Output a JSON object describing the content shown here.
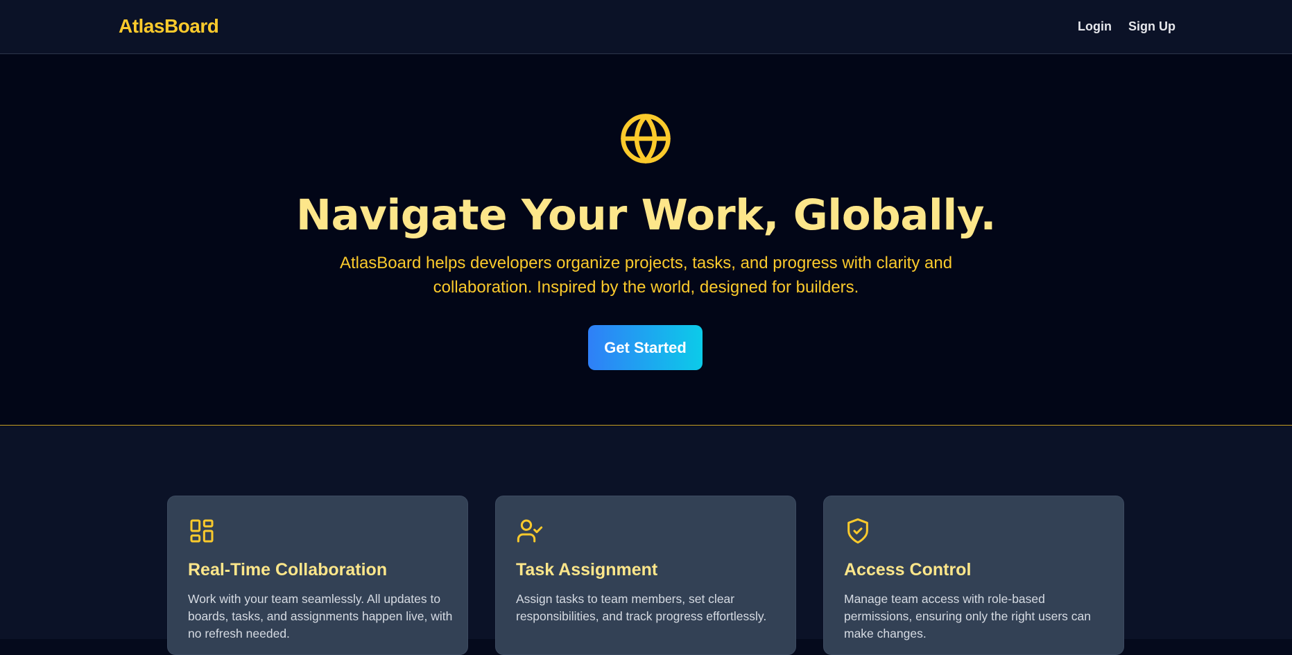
{
  "nav": {
    "brand": "AtlasBoard",
    "login_label": "Login",
    "signup_label": "Sign Up"
  },
  "hero": {
    "icon": "globe-icon",
    "title": "Navigate Your Work, Globally.",
    "subtitle": "AtlasBoard helps developers organize projects, tasks, and progress with clarity and collaboration. Inspired by the world, designed for builders.",
    "cta_label": "Get Started"
  },
  "features": [
    {
      "icon": "dashboard-grid-icon",
      "title": "Real-Time Collaboration",
      "description": "Work with your team seamlessly. All updates to boards, tasks, and assignments happen live, with no refresh needed."
    },
    {
      "icon": "user-check-icon",
      "title": "Task Assignment",
      "description": "Assign tasks to team members, set clear responsibilities, and track progress effortlessly."
    },
    {
      "icon": "shield-check-icon",
      "title": "Access Control",
      "description": "Manage team access with role-based permissions, ensuring only the right users can make changes."
    }
  ],
  "colors": {
    "accent": "#fbca2c",
    "title": "#fde68a",
    "background": "#020617",
    "navbar": "#0b1227",
    "card": "#334155",
    "cta_gradient_start": "#2f7ff7",
    "cta_gradient_end": "#0ccbe9"
  }
}
